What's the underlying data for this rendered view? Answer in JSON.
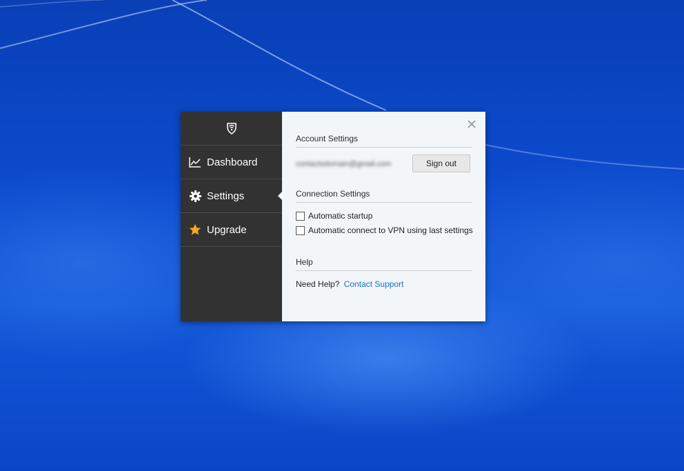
{
  "sidebar": {
    "logo_icon": "shield-wifi-icon",
    "items": [
      {
        "label": "Dashboard",
        "icon": "chart-line-icon"
      },
      {
        "label": "Settings",
        "icon": "gear-icon",
        "active": true
      },
      {
        "label": "Upgrade",
        "icon": "star-icon"
      }
    ]
  },
  "account": {
    "title": "Account Settings",
    "email": "contactsdomain@gmail.com",
    "sign_out_label": "Sign out"
  },
  "connection": {
    "title": "Connection Settings",
    "options": [
      {
        "label": "Automatic startup",
        "checked": false
      },
      {
        "label": "Automatic connect to VPN using last settings",
        "checked": false
      }
    ]
  },
  "help": {
    "title": "Help",
    "prompt": "Need Help?",
    "link": "Contact Support"
  },
  "colors": {
    "sidebar_bg": "#323232",
    "panel_bg": "#f3f6f9",
    "accent_link": "#1a6fc4",
    "star": "#f5a623"
  }
}
